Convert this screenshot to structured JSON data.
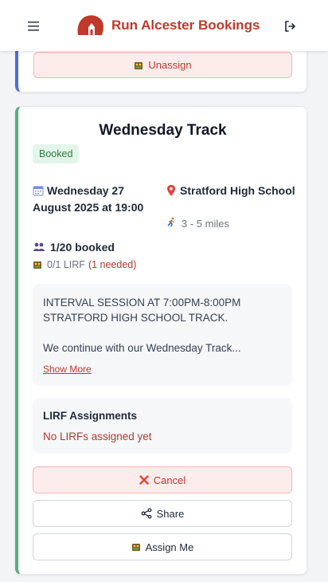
{
  "header": {
    "title": "Run Alcester Bookings",
    "menu_icon": "hamburger-menu-icon",
    "logout_icon": "logout-icon",
    "brand_color": "#c0392b"
  },
  "previous_card": {
    "unassign_label": "Unassign",
    "accent_color": "#4f6fd6"
  },
  "event": {
    "title": "Wednesday Track",
    "status": "Booked",
    "date": "Wednesday 27 August 2025 at 19:00",
    "location": "Stratford High School",
    "distance": "3 - 5 miles",
    "booked": "1/20 booked",
    "lirf_count": "0/1 LIRF",
    "lirf_needed": "(1 needed)",
    "description_line1": "INTERVAL SESSION AT 7:00PM-8:00PM STRATFORD HIGH SCHOOL TRACK.",
    "description_line2": "We continue with our Wednesday Track...",
    "show_more": "Show More",
    "lirf_section_title": "LIRF Assignments",
    "lirf_section_empty": "No LIRFs assigned yet",
    "accent_color": "#55b07a"
  },
  "actions": {
    "cancel_label": "Cancel",
    "share_label": "Share",
    "assign_label": "Assign Me"
  }
}
